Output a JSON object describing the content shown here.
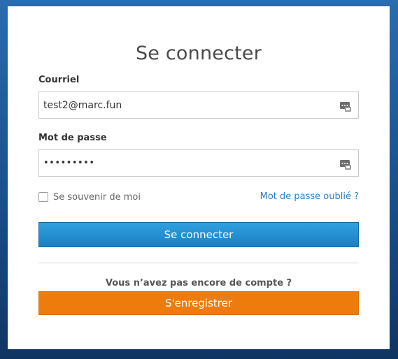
{
  "login": {
    "title": "Se connecter",
    "email_label": "Courriel",
    "email_value": "test2@marc.fun",
    "password_label": "Mot de passe",
    "password_value": "password1",
    "remember_label": "Se souvenir de moi",
    "remember_checked": false,
    "forgot_label": "Mot de passe oublié ?",
    "submit_label": "Se connecter",
    "no_account_label": "Vous n’avez pas encore de compte ?",
    "register_label": "S'enregistrer"
  },
  "icons": {
    "email_field_icon": "password-manager-icon",
    "password_field_icon": "password-manager-icon"
  },
  "colors": {
    "primary_button": "#1b8ad0",
    "register_button": "#ee7c0d",
    "link": "#2a80c6",
    "background": "#1a4f8a"
  }
}
